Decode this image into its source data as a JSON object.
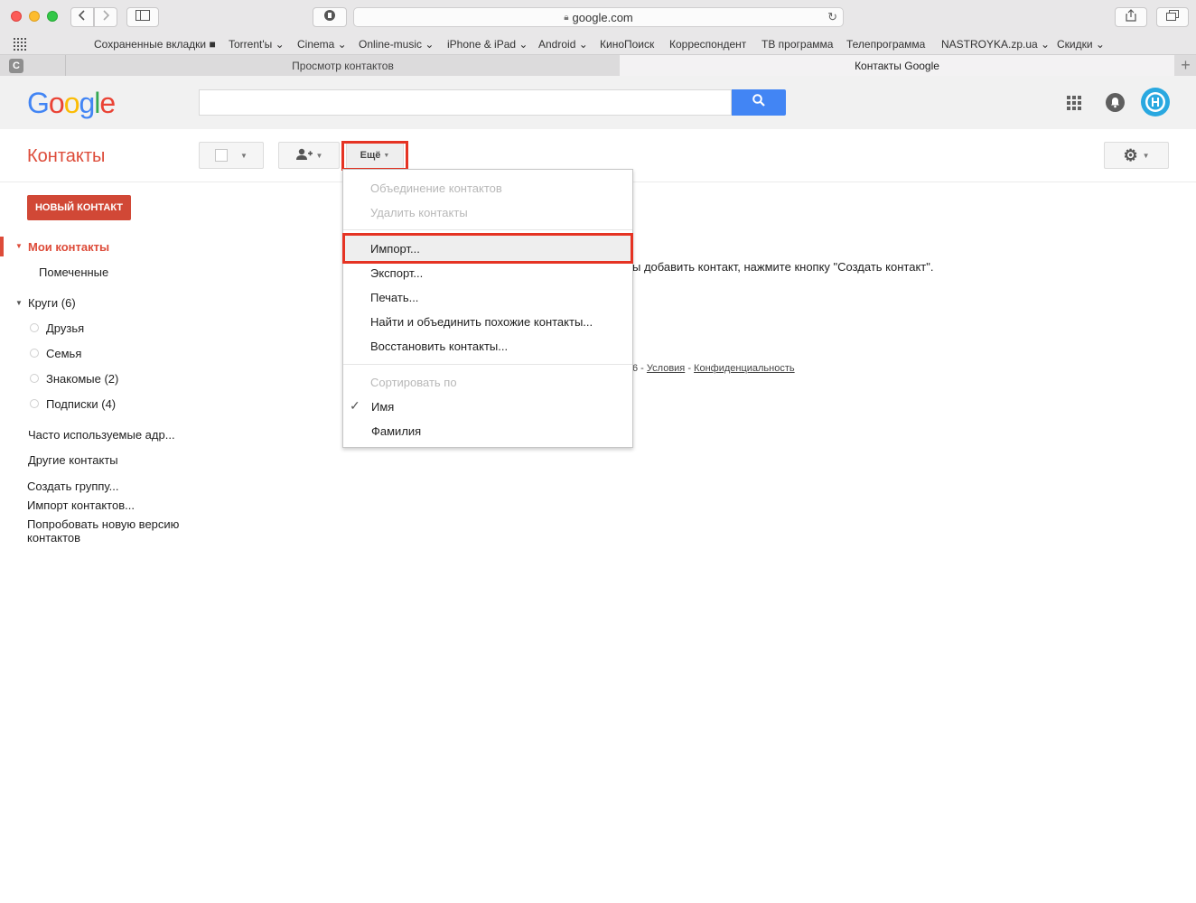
{
  "browser": {
    "url": "google.com",
    "bookmarks": [
      "Сохраненные вкладки ■",
      "Torrent'ы ⌄",
      "Cinema ⌄",
      "Online-music ⌄",
      "iPhone & iPad ⌄",
      "Android ⌄",
      "КиноПоиск",
      "Корреспондент",
      "ТВ программа",
      "Телепрограмма",
      "NASTROYKA.zp.ua ⌄",
      "Скидки ⌄"
    ],
    "tabs": [
      "Просмотр контактов",
      "Контакты Google"
    ],
    "pinned_tab": "C"
  },
  "google": {
    "logo_letters": [
      "G",
      "o",
      "o",
      "g",
      "l",
      "e"
    ],
    "logo_colors": [
      "#4285f4",
      "#ea4335",
      "#fbbc05",
      "#4285f4",
      "#34a853",
      "#ea4335"
    ]
  },
  "toolbar": {
    "title": "Контакты",
    "more_label": "Ещё"
  },
  "sidebar": {
    "new_contact": "НОВЫЙ КОНТАКТ",
    "my_contacts": "Мои контакты",
    "starred": "Помеченные",
    "circles": "Круги (6)",
    "circle_items": [
      "Друзья",
      "Семья",
      "Знакомые (2)",
      "Подписки (4)"
    ],
    "frequent": "Часто используемые адр...",
    "other": "Другие контакты",
    "create_group": "Создать группу...",
    "import": "Импорт контактов...",
    "try_new_1": "Попробовать новую версию",
    "try_new_2": "контактов"
  },
  "main": {
    "message": "ы добавить контакт, нажмите кнопку \"Создать контакт\".",
    "footer_prefix": "6 - ",
    "terms": "Условия",
    "sep": " - ",
    "privacy": "Конфиденциальность"
  },
  "menu": {
    "merge": "Объединение контактов",
    "delete": "Удалить контакты",
    "import": "Импорт...",
    "export": "Экспорт...",
    "print": "Печать...",
    "find_merge": "Найти и объединить похожие контакты...",
    "restore": "Восстановить контакты...",
    "sort_by": "Сортировать по",
    "sort_name": "Имя",
    "sort_surname": "Фамилия",
    "checkmark": "✓"
  },
  "colors": {
    "accent_red": "#dd4b39",
    "highlight_red": "#e53323",
    "search_blue": "#4285f4"
  }
}
